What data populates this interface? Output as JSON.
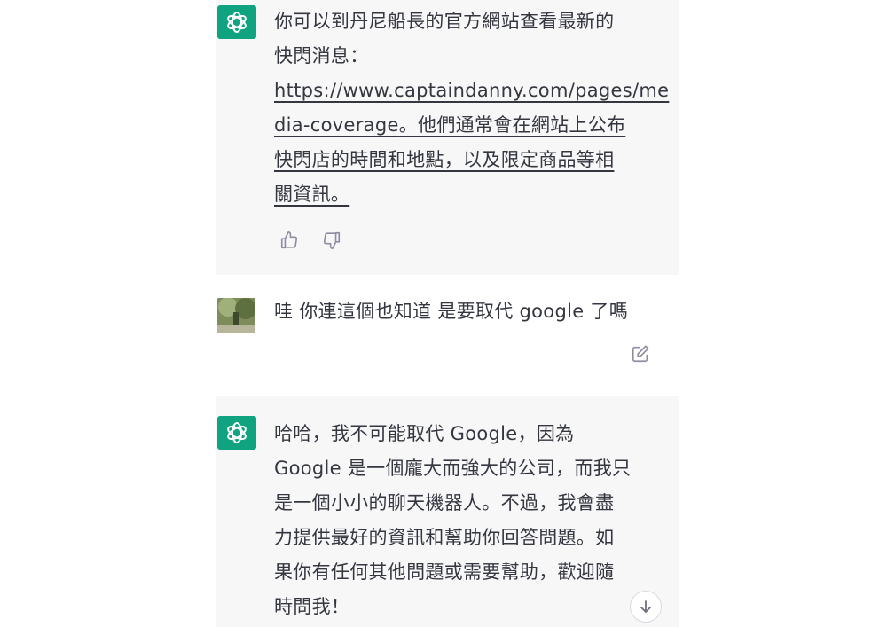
{
  "conversation": {
    "messages": [
      {
        "role": "assistant",
        "avatar_icon": "openai-logo-icon",
        "lines": [
          "你可以到丹尼船長的官方網站查看最新的",
          "快閃消息："
        ],
        "link_lines": [
          "https://www.captaindanny.com/pages/me",
          "dia-coverage"
        ],
        "link_tail": "。他們通常會在網站上公布",
        "underlined_lines": [
          "快閃店的時間和地點，以及限定商品等相",
          "關資訊。"
        ],
        "actions": {
          "thumbs_up_icon": "thumbs-up-icon",
          "thumbs_down_icon": "thumbs-down-icon"
        }
      },
      {
        "role": "user",
        "avatar_icon": "user-photo-avatar",
        "text": "哇 你連這個也知道 是要取代 google 了嗎",
        "edit_icon": "edit-icon"
      },
      {
        "role": "assistant",
        "avatar_icon": "openai-logo-icon",
        "lines": [
          "哈哈，我不可能取代 Google，因為",
          "Google 是一個龐大而強大的公司，而我只",
          "是一個小小的聊天機器人。不過，我會盡",
          "力提供最好的資訊和幫助你回答問題。如",
          "果你有任何其他問題或需要幫助，歡迎隨",
          "時問我！"
        ]
      }
    ],
    "scroll_down_icon": "arrow-down-icon"
  },
  "colors": {
    "assistant_bg": "#f7f7f8",
    "accent_green": "#10a37f",
    "text": "#353740",
    "icon_gray": "#8e8ea0"
  }
}
